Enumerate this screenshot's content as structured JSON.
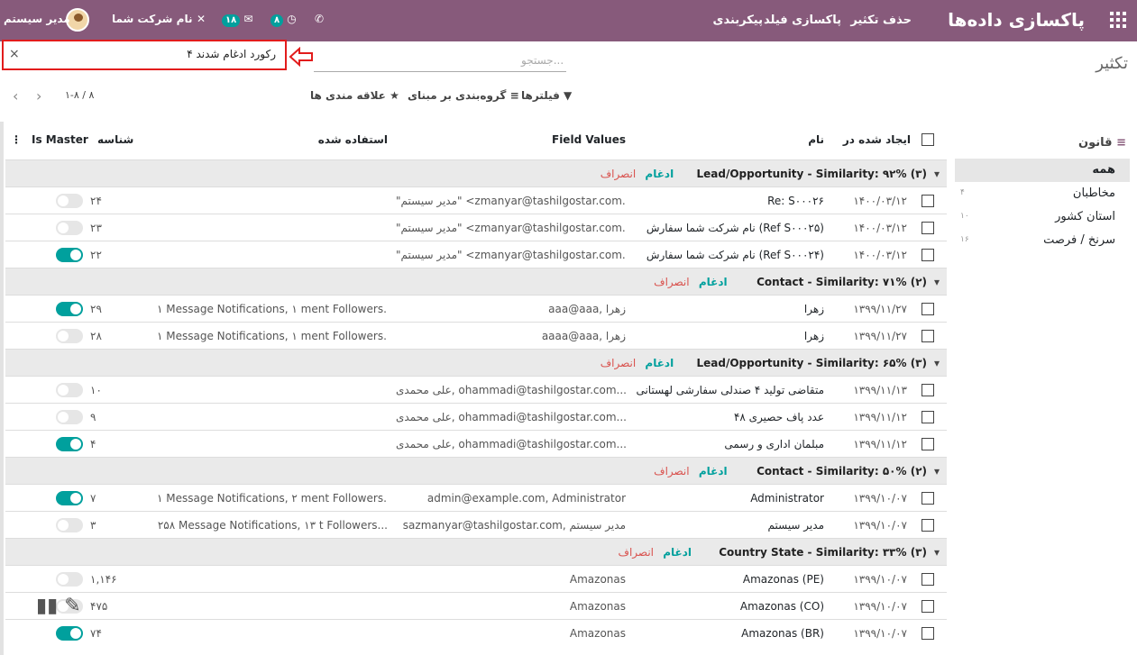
{
  "header": {
    "brand": "پاکسازی داده‌ها",
    "menu": [
      "حذف تکثیر",
      "پاکسازی فیلد",
      "پیکربندی"
    ],
    "company": "نام شرکت شما",
    "user": "مدیر سیستم",
    "badges": {
      "activity": "۸",
      "messages": "۱۸"
    }
  },
  "page_title": "تکثیر",
  "search": {
    "facet": "۴ رکورد ادغام شدند",
    "placeholder": "جستجو..."
  },
  "toolbar": {
    "filters": "فیلترها",
    "groupby": "گروه‌بندی بر مبنای",
    "favorites": "علاقه مندی ها",
    "pager": "۱-۸ / ۸"
  },
  "sidebar": {
    "title": "قانون",
    "items": [
      {
        "label": "همه",
        "count": ""
      },
      {
        "label": "مخاطبان",
        "count": "۴"
      },
      {
        "label": "استان کشور",
        "count": "۱۰"
      },
      {
        "label": "سرنخ / فرصت",
        "count": "۱۶"
      }
    ]
  },
  "table": {
    "headers": {
      "created": "ایجاد شده در",
      "name": "نام",
      "field_values": "Field Values",
      "used_in": "استفاده شده",
      "id": "شناسه",
      "is_master": "Is Master"
    },
    "merge": "ادغام",
    "discard": "انصراف",
    "groups": [
      {
        "title": "Lead/Opportunity - Similarity: ۹۲% (۳)",
        "rows": [
          {
            "date": "۱۴۰۰/۰۳/۱۲",
            "name": "Re: S۰۰۰۲۶",
            "values": "\"مدیر سیستم\" <zmanyar@tashilgostar.com...",
            "used": "",
            "id": "۲۴",
            "master": false
          },
          {
            "date": "۱۴۰۰/۰۳/۱۲",
            "name": "نام شرکت شما سفارش (Ref S۰۰۰۲۵)",
            "values": "\"مدیر سیستم\" <zmanyar@tashilgostar.com...",
            "used": "",
            "id": "۲۳",
            "master": false
          },
          {
            "date": "۱۴۰۰/۰۳/۱۲",
            "name": "نام شرکت شما سفارش (Ref S۰۰۰۲۴)",
            "values": "\"مدیر سیستم\" <zmanyar@tashilgostar.com...",
            "used": "",
            "id": "۲۲",
            "master": true
          }
        ]
      },
      {
        "title": "Contact - Similarity: ۷۱% (۲)",
        "rows": [
          {
            "date": "۱۳۹۹/۱۱/۲۷",
            "name": "زهرا",
            "values": "aaa@aaa, زهرا",
            "used": "۱ Message Notifications, ۱ ment Followers...",
            "id": "۲۹",
            "master": true
          },
          {
            "date": "۱۳۹۹/۱۱/۲۷",
            "name": "زهرا",
            "values": "aaaa@aaa, زهرا",
            "used": "۱ Message Notifications, ۱ ment Followers...",
            "id": "۲۸",
            "master": false
          }
        ]
      },
      {
        "title": "Lead/Opportunity - Similarity: ۶۵% (۳)",
        "rows": [
          {
            "date": "۱۳۹۹/۱۱/۱۳",
            "name": "متقاضی تولید ۴ صندلی سفارشی لهستانی",
            "values": "علی محمدی, ohammadi@tashilgostar.com...",
            "used": "",
            "id": "۱۰",
            "master": false
          },
          {
            "date": "۱۳۹۹/۱۱/۱۲",
            "name": "۴۸ عدد پاف حصیری",
            "values": "علی محمدی, ohammadi@tashilgostar.com...",
            "used": "",
            "id": "۹",
            "master": false
          },
          {
            "date": "۱۳۹۹/۱۱/۱۲",
            "name": "مبلمان اداری و رسمی",
            "values": "علی محمدی, ohammadi@tashilgostar.com...",
            "used": "",
            "id": "۴",
            "master": true
          }
        ]
      },
      {
        "title": "Contact - Similarity: ۵۰% (۲)",
        "rows": [
          {
            "date": "۱۳۹۹/۱۰/۰۷",
            "name": "Administrator",
            "values": "admin@example.com, Administrator",
            "used": "۱ Message Notifications, ۲ ment Followers...",
            "id": "۷",
            "master": true
          },
          {
            "date": "۱۳۹۹/۱۰/۰۷",
            "name": "مدیر سیستم",
            "values": "sazmanyar@tashilgostar.com, مدیر سیستم",
            "used": "۲۵۸ Message Notifications, ۱۳ t Followers...",
            "id": "۳",
            "master": false
          }
        ]
      },
      {
        "title": "Country State - Similarity: ۳۳% (۳)",
        "rows": [
          {
            "date": "۱۳۹۹/۱۰/۰۷",
            "name": "Amazonas (PE)",
            "values": "Amazonas",
            "used": "",
            "id": "۱,۱۴۶",
            "master": false
          },
          {
            "date": "۱۳۹۹/۱۰/۰۷",
            "name": "Amazonas (CO)",
            "values": "Amazonas",
            "used": "",
            "id": "۴۷۵",
            "master": false
          },
          {
            "date": "۱۳۹۹/۱۰/۰۷",
            "name": "Amazonas (BR)",
            "values": "Amazonas",
            "used": "",
            "id": "۷۴",
            "master": true
          }
        ]
      }
    ]
  },
  "colors": {
    "topbar": "#875a7b",
    "accent": "#00a09d",
    "discard": "#d9534f"
  }
}
